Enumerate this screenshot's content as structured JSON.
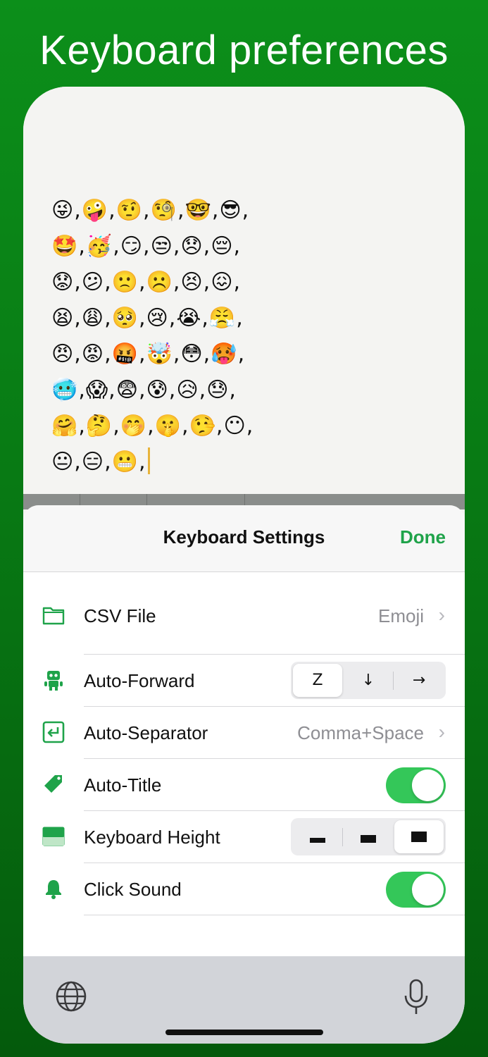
{
  "headline": "Keyboard preferences",
  "editor": {
    "emoji_lines": [
      "😜,🤪,🤨,🧐,🤓,😎,",
      "🤩,🥳,😏,😒,😞,😔,",
      "😟,😕,🙁,☹️,😣,😖,",
      "😫,😩,🥺,😢,😭,😤,",
      "😠,😡,🤬,🤯,😳,🥵,",
      "🥶,😱,😨,😰,😥,😓,",
      "🤗,🤔,🤭,🤫,🤥,😶,",
      "😐,😑,😬,"
    ]
  },
  "sheet": {
    "title": "Keyboard Settings",
    "done": "Done",
    "rows": {
      "csv": {
        "label": "CSV File",
        "value": "Emoji",
        "icon": "folder-icon"
      },
      "forward": {
        "label": "Auto-Forward",
        "options": [
          "Z",
          "↓",
          "→"
        ],
        "selected": 0,
        "icon": "robot-icon"
      },
      "separator": {
        "label": "Auto-Separator",
        "value": "Comma+Space",
        "icon": "return-icon"
      },
      "title": {
        "label": "Auto-Title",
        "on": true,
        "icon": "tag-icon"
      },
      "height": {
        "label": "Keyboard Height",
        "options": [
          "small",
          "medium",
          "large"
        ],
        "selected": 2,
        "icon": "keyboard-height-icon"
      },
      "sound": {
        "label": "Click Sound",
        "on": true,
        "icon": "bell-icon"
      }
    }
  },
  "colors": {
    "accent": "#1fa34a",
    "toggle_on": "#34c759",
    "background": "#0c8f1a"
  }
}
